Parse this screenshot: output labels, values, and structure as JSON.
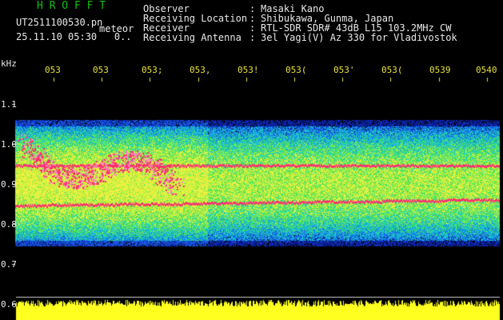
{
  "app": {
    "title": "H R O F F T"
  },
  "file": {
    "name": "UT2511100530.pn",
    "type_label": "meteor",
    "datetime": "25.11.10 05:30",
    "count": "0.."
  },
  "info": [
    {
      "label": "Observer",
      "value": "Masaki Kano"
    },
    {
      "label": "Receiving Location",
      "value": "Shibukawa, Gunma, Japan"
    },
    {
      "label": "Receiver",
      "value": "RTL-SDR SDR# 43dB L15 103.2MHz CW"
    },
    {
      "label": "Receiving Antenna",
      "value": "3el Yagi(V) Az 330 for Vladivostok"
    }
  ],
  "y_axis": {
    "unit": "kHz",
    "ticks": [
      "1.1",
      "1.0",
      "0.9",
      "0.8",
      "0.7",
      "0.6"
    ]
  },
  "x_axis": {
    "ticks": [
      "053",
      "053",
      "053;",
      "053,",
      "053!",
      "053(",
      "053'",
      "053(",
      "0539",
      "0540"
    ]
  },
  "colors": {
    "background": "#000000",
    "text": "#e8e8e8",
    "title_green": "#10c010",
    "tick_yellow": "#e8e03a",
    "signal_red": "#ff3070",
    "noise_blue": "#1030c8",
    "level_yellow": "#ffff20"
  }
}
